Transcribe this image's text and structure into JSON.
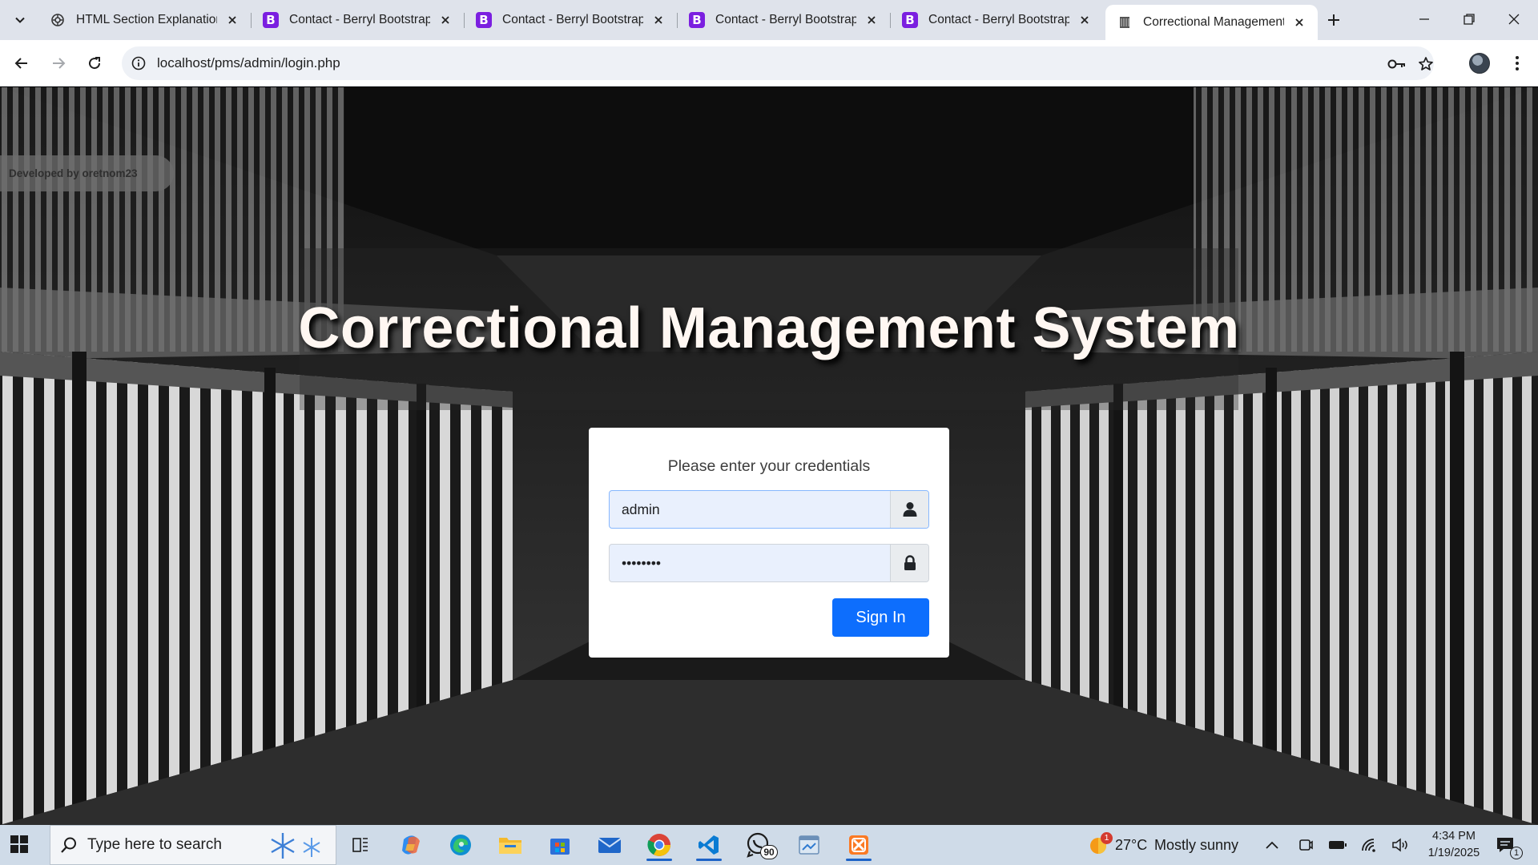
{
  "browser": {
    "tabs": [
      {
        "title": "HTML Section Explanation",
        "favicon": "openai-icon",
        "active": false
      },
      {
        "title": "Contact - Berryl Bootstrap",
        "favicon": "bootstrap-icon",
        "active": false
      },
      {
        "title": "Contact - Berryl Bootstrap",
        "favicon": "bootstrap-icon",
        "active": false
      },
      {
        "title": "Contact - Berryl Bootstrap",
        "favicon": "bootstrap-icon",
        "active": false
      },
      {
        "title": "Contact - Berryl Bootstrap",
        "favicon": "bootstrap-icon",
        "active": false
      },
      {
        "title": "Correctional Management",
        "favicon": "page-icon",
        "active": true
      }
    ],
    "url": "localhost/pms/admin/login.php"
  },
  "page": {
    "developer_badge": "Developed by oretnom23",
    "heading": "Correctional Management System",
    "login": {
      "prompt": "Please enter your credentials",
      "username_value": "admin",
      "password_value": "••••••••",
      "signin_label": "Sign In"
    },
    "colors": {
      "primary_button": "#0d6efd",
      "heading_text": "#fff7f2"
    }
  },
  "taskbar": {
    "search_placeholder": "Type here to search",
    "whatsapp_badge": "90",
    "weather_badge": "1",
    "temperature": "27°C",
    "weather": "Mostly sunny",
    "time": "4:34 PM",
    "date": "1/19/2025",
    "notification_count": "1"
  }
}
